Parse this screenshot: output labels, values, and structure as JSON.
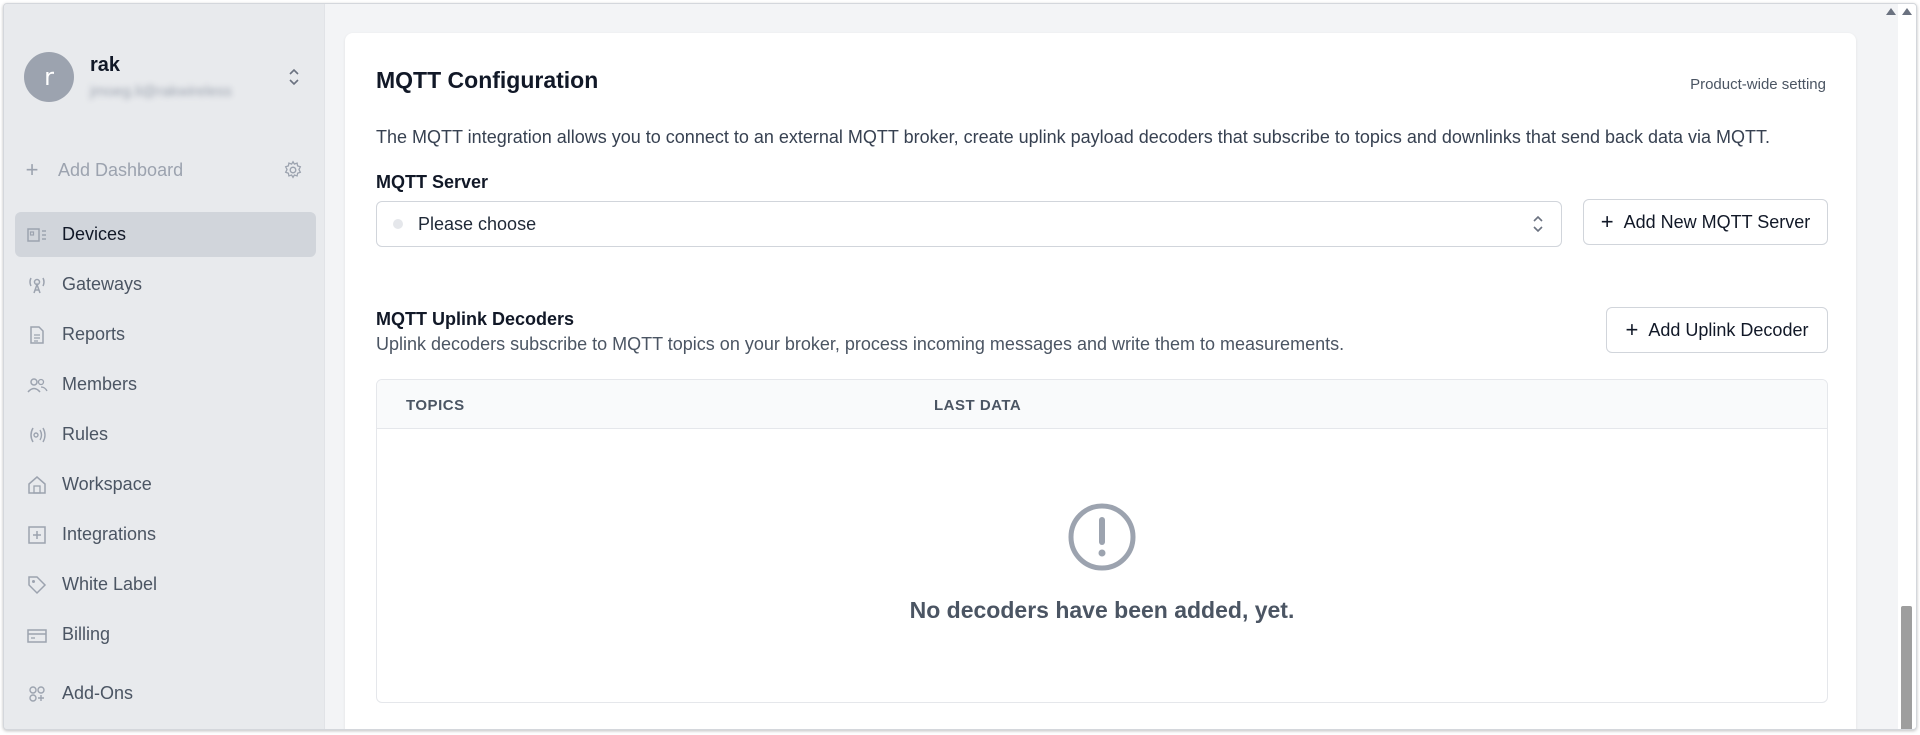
{
  "user": {
    "avatar_letter": "r",
    "name": "rak",
    "email": "jmoeg.li@rakwireless"
  },
  "sidebar": {
    "add_dashboard_label": "Add Dashboard",
    "items": [
      {
        "label": "Devices",
        "icon": "devices-icon",
        "active": true
      },
      {
        "label": "Gateways",
        "icon": "gateway-icon",
        "active": false
      },
      {
        "label": "Reports",
        "icon": "report-icon",
        "active": false
      },
      {
        "label": "Members",
        "icon": "members-icon",
        "active": false
      },
      {
        "label": "Rules",
        "icon": "rules-icon",
        "active": false
      },
      {
        "label": "Workspace",
        "icon": "workspace-icon",
        "active": false
      },
      {
        "label": "Integrations",
        "icon": "integrations-icon",
        "active": false
      },
      {
        "label": "White Label",
        "icon": "tag-icon",
        "active": false
      },
      {
        "label": "Billing",
        "icon": "billing-icon",
        "active": false
      },
      {
        "label": "Add-Ons",
        "icon": "addons-icon",
        "active": false
      }
    ]
  },
  "main": {
    "title": "MQTT Configuration",
    "scope_note": "Product-wide setting",
    "intro": "The MQTT integration allows you to connect to an external MQTT broker, create uplink payload decoders that subscribe to topics and downlinks that send back data via MQTT.",
    "server": {
      "label": "MQTT Server",
      "select_value": "Please choose",
      "add_button": "Add New MQTT Server"
    },
    "decoders": {
      "title": "MQTT Uplink Decoders",
      "description": "Uplink decoders subscribe to MQTT topics on your broker, process incoming messages and write them to measurements.",
      "add_button": "Add Uplink Decoder",
      "columns": [
        "TOPICS",
        "LAST DATA"
      ],
      "empty_message": "No decoders have been added, yet."
    }
  },
  "colors": {
    "sidebar_bg": "#e8eaed",
    "active_item_bg": "#d1d5db",
    "page_bg": "#f3f4f6",
    "card_bg": "#ffffff"
  }
}
